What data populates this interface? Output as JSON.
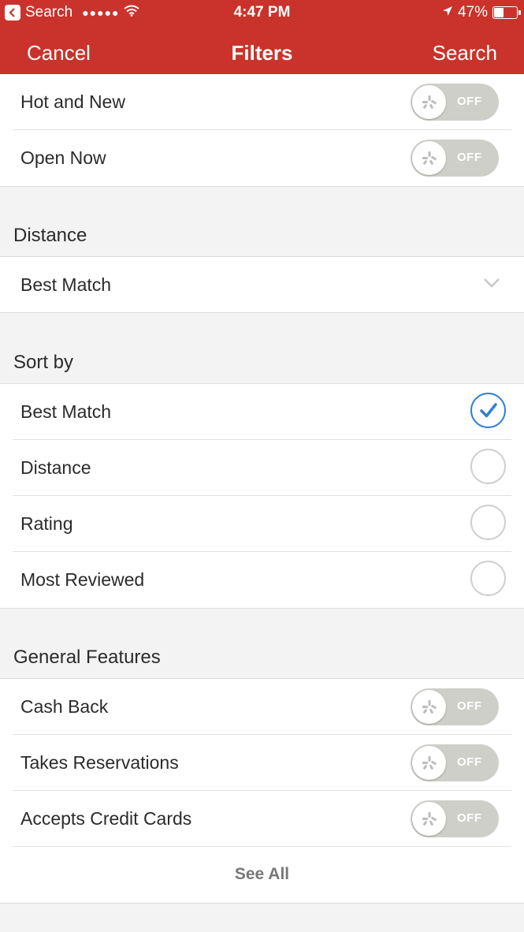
{
  "status_bar": {
    "back_app": "Search",
    "signal": "●●●●●",
    "time": "4:47 PM",
    "battery": "47%",
    "battery_level": 0.47
  },
  "nav": {
    "cancel": "Cancel",
    "title": "Filters",
    "search": "Search"
  },
  "top_toggles": [
    {
      "label": "Hot and New",
      "state": "OFF"
    },
    {
      "label": "Open Now",
      "state": "OFF"
    }
  ],
  "distance": {
    "title": "Distance",
    "selected": "Best Match"
  },
  "sort_by": {
    "title": "Sort by",
    "options": [
      {
        "label": "Best Match",
        "checked": true
      },
      {
        "label": "Distance",
        "checked": false
      },
      {
        "label": "Rating",
        "checked": false
      },
      {
        "label": "Most Reviewed",
        "checked": false
      }
    ]
  },
  "general_features": {
    "title": "General Features",
    "items": [
      {
        "label": "Cash Back",
        "state": "OFF"
      },
      {
        "label": "Takes Reservations",
        "state": "OFF"
      },
      {
        "label": "Accepts Credit Cards",
        "state": "OFF"
      }
    ],
    "see_all": "See All"
  },
  "colors": {
    "header_red": "#c9332b",
    "toggle_off": "#cfcfc9",
    "radio_checked": "#2f7fd6"
  }
}
